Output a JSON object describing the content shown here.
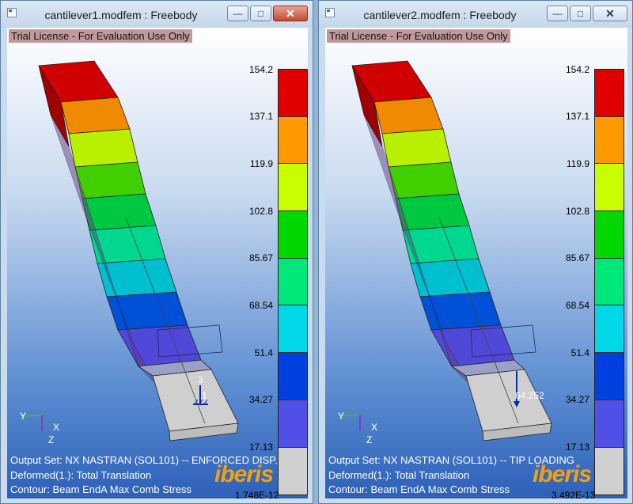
{
  "windows": [
    {
      "title": "cantilever1.modfem : Freebody",
      "license": "Trial License - For Evaluation Use Only",
      "output_set": "Output Set: NX NASTRAN (SOL101) -- ENFORCED DISP.",
      "deformed": "Deformed(1.): Total Translation",
      "contour": "Contour: Beam EndA Max Comb Stress",
      "bottom_value": "1.748E-12",
      "marker_a": "3",
      "marker_b": "1"
    },
    {
      "title": "cantilever2.modfem : Freebody",
      "license": "Trial License - For Evaluation Use Only",
      "output_set": "Output Set: NX NASTRAN (SOL101) -- TIP LOADING",
      "deformed": "Deformed(1.): Total Translation",
      "contour": "Contour: Beam EndA Max Comb Stress",
      "bottom_value": "3.492E-13",
      "marker_a": "64.252"
    }
  ],
  "legend_ticks": [
    "154.2",
    "137.1",
    "119.9",
    "102.8",
    "85.67",
    "68.54",
    "51.4",
    "34.27",
    "17.13"
  ],
  "legend_colors": [
    "#e00000",
    "#ff9900",
    "#c8ff00",
    "#00d800",
    "#00e87a",
    "#00d8e8",
    "#0040e0",
    "#5050e8",
    "#d0d0d0"
  ],
  "logo": "iberis",
  "axis": {
    "y": "Y",
    "x": "X",
    "z": "Z"
  },
  "buttons": {
    "minimize": "—",
    "maximize": "□",
    "close": "✕"
  }
}
